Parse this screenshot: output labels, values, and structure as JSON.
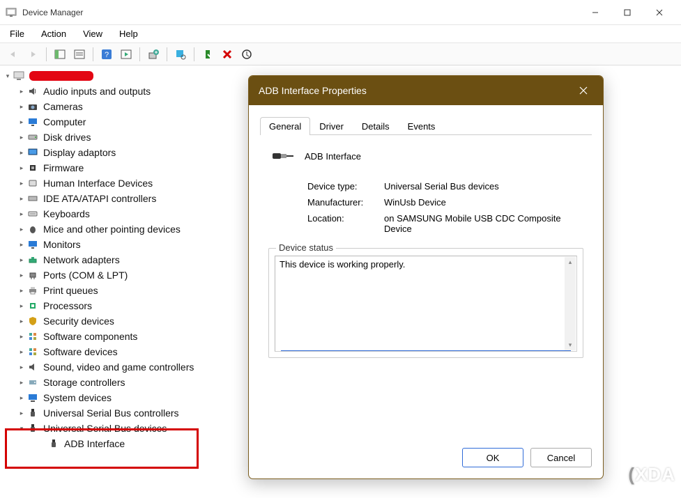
{
  "window": {
    "title": "Device Manager"
  },
  "menu": {
    "file": "File",
    "action": "Action",
    "view": "View",
    "help": "Help"
  },
  "tree": {
    "root_redacted": true,
    "items": [
      {
        "label": "Audio inputs and outputs",
        "icon": "speaker"
      },
      {
        "label": "Cameras",
        "icon": "camera"
      },
      {
        "label": "Computer",
        "icon": "monitor"
      },
      {
        "label": "Disk drives",
        "icon": "disk"
      },
      {
        "label": "Display adaptors",
        "icon": "display"
      },
      {
        "label": "Firmware",
        "icon": "chip"
      },
      {
        "label": "Human Interface Devices",
        "icon": "hid"
      },
      {
        "label": "IDE ATA/ATAPI controllers",
        "icon": "ide"
      },
      {
        "label": "Keyboards",
        "icon": "keyboard"
      },
      {
        "label": "Mice and other pointing devices",
        "icon": "mouse"
      },
      {
        "label": "Monitors",
        "icon": "monitor2"
      },
      {
        "label": "Network adapters",
        "icon": "network"
      },
      {
        "label": "Ports (COM & LPT)",
        "icon": "port"
      },
      {
        "label": "Print queues",
        "icon": "printer"
      },
      {
        "label": "Processors",
        "icon": "cpu"
      },
      {
        "label": "Security devices",
        "icon": "shield"
      },
      {
        "label": "Software components",
        "icon": "sw"
      },
      {
        "label": "Software devices",
        "icon": "sw"
      },
      {
        "label": "Sound, video and game controllers",
        "icon": "sound"
      },
      {
        "label": "Storage controllers",
        "icon": "storage"
      },
      {
        "label": "System devices",
        "icon": "system"
      },
      {
        "label": "Universal Serial Bus controllers",
        "icon": "usb"
      }
    ],
    "usb_devices": {
      "label": "Universal Serial Bus devices",
      "expanded": true,
      "children": [
        {
          "label": "ADB Interface"
        }
      ]
    }
  },
  "dialog": {
    "title": "ADB Interface Properties",
    "tabs": {
      "general": "General",
      "driver": "Driver",
      "details": "Details",
      "events": "Events"
    },
    "active_tab": "general",
    "device_name": "ADB Interface",
    "info": {
      "device_type_label": "Device type:",
      "device_type": "Universal Serial Bus devices",
      "manufacturer_label": "Manufacturer:",
      "manufacturer": "WinUsb Device",
      "location_label": "Location:",
      "location": "on SAMSUNG Mobile USB CDC Composite Device"
    },
    "status_legend": "Device status",
    "status_text": "This device is working properly.",
    "buttons": {
      "ok": "OK",
      "cancel": "Cancel"
    }
  },
  "watermark": "XDA"
}
